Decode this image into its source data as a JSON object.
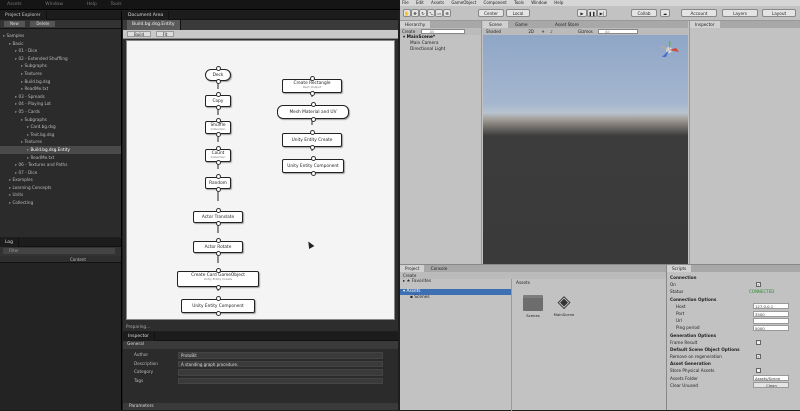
{
  "topbar": {
    "items": [
      "Assets",
      "Window",
      "Help",
      "Tools"
    ]
  },
  "project_explorer": {
    "title": "Project Explorer",
    "toolbar": [
      "New",
      "Delete"
    ],
    "items": [
      {
        "label": "Samples",
        "indent": 0
      },
      {
        "label": "Basic",
        "indent": 1
      },
      {
        "label": "01 - Dice",
        "indent": 2
      },
      {
        "label": "02 - Extended Shuffling",
        "indent": 2
      },
      {
        "label": "Subgraphs",
        "indent": 3
      },
      {
        "label": "Textures",
        "indent": 3
      },
      {
        "label": "Build.bg.dsg",
        "indent": 3
      },
      {
        "label": "ReadMe.txt",
        "indent": 3
      },
      {
        "label": "03 - Spreads",
        "indent": 2
      },
      {
        "label": "04 - Playing Lot",
        "indent": 2
      },
      {
        "label": "05 - Cards",
        "indent": 2
      },
      {
        "label": "Subgraphs",
        "indent": 3
      },
      {
        "label": "Card.bg.dsg",
        "indent": 4
      },
      {
        "label": "Text.bg.dsg",
        "indent": 4
      },
      {
        "label": "Textures",
        "indent": 3
      },
      {
        "label": "Build.bg.dsg.Entity",
        "indent": 4,
        "selected": true
      },
      {
        "label": "ReadMe.txt",
        "indent": 4
      },
      {
        "label": "06 - Textures and Paths",
        "indent": 2
      },
      {
        "label": "07 - Dice",
        "indent": 2
      },
      {
        "label": "Examples",
        "indent": 1
      },
      {
        "label": "Learning Concepts",
        "indent": 1
      },
      {
        "label": "Units",
        "indent": 1
      },
      {
        "label": "Collecting",
        "indent": 1
      }
    ]
  },
  "log": {
    "title": "Log",
    "filter": "Filter",
    "column": "Content"
  },
  "document": {
    "title": "Document Area",
    "tab": "Build.bg.dsg.Entity",
    "toolbar": [
      "Build",
      "Fit"
    ],
    "status": "Preparing...",
    "nodes": [
      {
        "label": "Deck",
        "sub": ""
      },
      {
        "label": "Copy",
        "sub": ""
      },
      {
        "label": "Shuffle",
        "sub": "Collection"
      },
      {
        "label": "Count",
        "sub": "Collection"
      },
      {
        "label": "Random",
        "sub": ""
      },
      {
        "label": "Actor Translate",
        "sub": ""
      },
      {
        "label": "Actor Rotate",
        "sub": ""
      },
      {
        "label": "Create Card GameObject",
        "sub": "Unity Entity Create"
      },
      {
        "label": "Unity Entity Component",
        "sub": ""
      },
      {
        "label": "Create Rectangle",
        "sub": "Rect Output"
      },
      {
        "label": "Mesh Material and UV",
        "sub": ""
      },
      {
        "label": "Unity Entity Create",
        "sub": ""
      },
      {
        "label": "Unity Entity Component",
        "sub": ""
      }
    ]
  },
  "inspector_left": {
    "title": "Inspector",
    "section": "General",
    "fields": [
      {
        "label": "Author",
        "value": "ProtoBit"
      },
      {
        "label": "Description",
        "value": "A standing graph procedure."
      },
      {
        "label": "Category",
        "value": ""
      },
      {
        "label": "Tags",
        "value": ""
      }
    ],
    "footer": "Parameters"
  },
  "unity": {
    "menu": [
      "File",
      "Edit",
      "Assets",
      "GameObject",
      "Component",
      "Tools",
      "Window",
      "Help"
    ],
    "toolbar": {
      "pivot": "Center",
      "space": "Local",
      "collab": "Collab",
      "account": "Account",
      "layers": "Layers",
      "layout": "Layout"
    },
    "hierarchy": {
      "title": "Hierarchy",
      "create": "Create",
      "search": "All",
      "scene": "MainScene*",
      "objects": [
        "Main Camera",
        "Directional Light"
      ]
    },
    "scene_tabs": [
      "Scene",
      "Game",
      "Asset Store"
    ],
    "scene_toolbar": {
      "shading": "Shaded",
      "mode": "2D",
      "gizmos": "Gizmos",
      "search": "All"
    },
    "inspector_title": "Inspector",
    "project": {
      "tabs": [
        "Project",
        "Console"
      ],
      "create": "Create",
      "tree": [
        {
          "label": "Favorites",
          "selected": false
        },
        {
          "label": "Assets",
          "selected": true
        },
        {
          "label": "Scenes",
          "selected": false
        }
      ],
      "breadcrumb": "Assets",
      "assets": [
        "Scenes",
        "MainScene"
      ]
    },
    "scripts": {
      "title": "Scripts",
      "connection": "Connection",
      "on_label": "On",
      "on": true,
      "status_label": "Status",
      "status_value": "CONNECTED",
      "status_color": "#2e8b2e",
      "conn_options": "Connection Options",
      "fields": [
        {
          "label": "Host",
          "value": "127.0.0.1"
        },
        {
          "label": "Port",
          "value": "3500"
        },
        {
          "label": "Url",
          "value": ""
        },
        {
          "label": "Ping period",
          "value": "5000"
        }
      ],
      "gen_options": "Generation Options",
      "frame_result": "Frame Result",
      "default_scene": "Default Scene Object Options",
      "remove_label": "Remove on regeneration",
      "asset_gen": "Asset Generation",
      "store_label": "Store Physical Assets",
      "assets_folder_label": "Assets Folder",
      "assets_folder": "Assets/Scene",
      "clear_label": "Clear Unused",
      "clear_btn": "Clean"
    }
  }
}
